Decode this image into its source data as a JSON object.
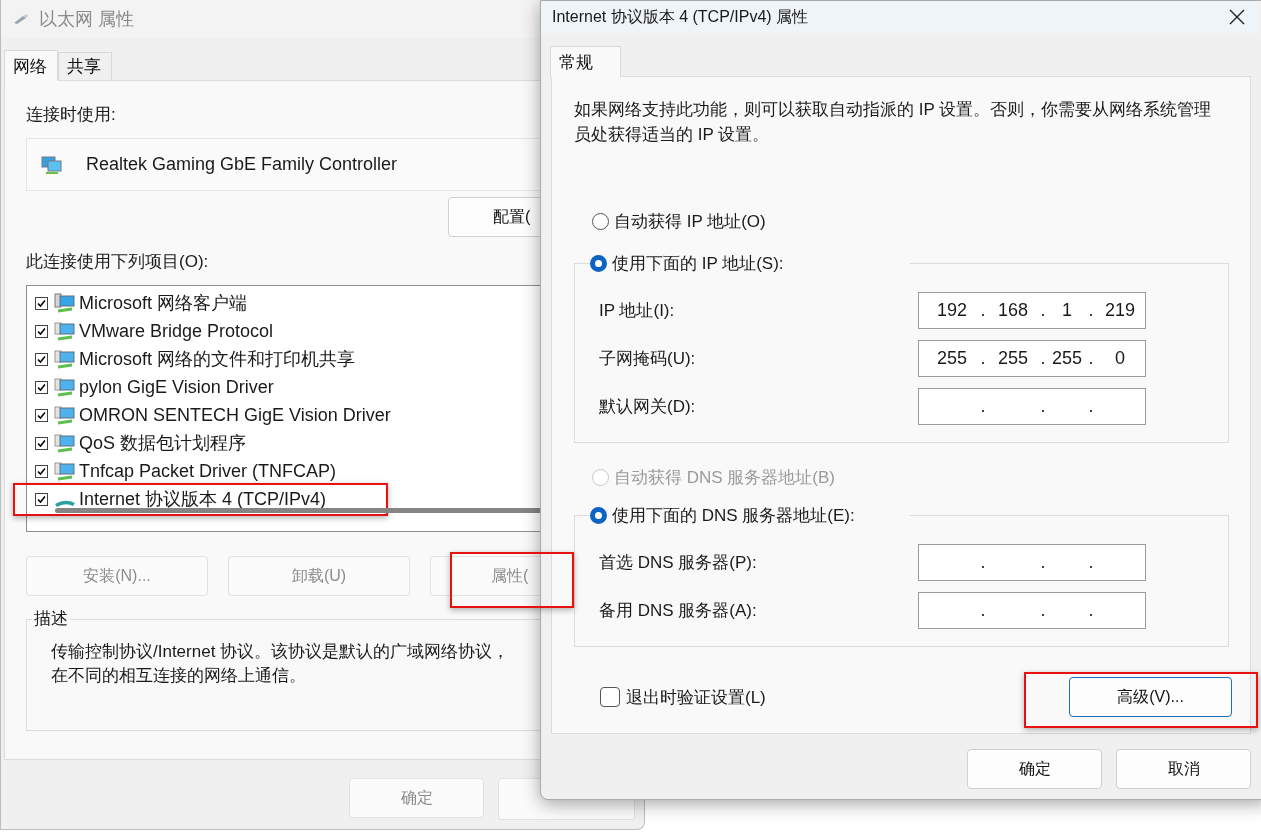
{
  "back_window": {
    "title": "以太网 属性",
    "tabs": [
      {
        "label": "网络",
        "selected": true
      },
      {
        "label": "共享",
        "selected": false
      }
    ],
    "connect_using_label": "连接时使用:",
    "adapter": "Realtek Gaming GbE Family Controller",
    "configure_button": "配置(",
    "items_label": "此连接使用下列项目(O):",
    "items": [
      {
        "label": "Microsoft 网络客户端",
        "checked": true,
        "highlighted": false,
        "kind": "client"
      },
      {
        "label": "VMware Bridge Protocol",
        "checked": true,
        "highlighted": false,
        "kind": "service"
      },
      {
        "label": "Microsoft 网络的文件和打印机共享",
        "checked": true,
        "highlighted": false,
        "kind": "service"
      },
      {
        "label": "pylon GigE Vision Driver",
        "checked": true,
        "highlighted": false,
        "kind": "service"
      },
      {
        "label": "OMRON SENTECH GigE Vision Driver",
        "checked": true,
        "highlighted": false,
        "kind": "service"
      },
      {
        "label": "QoS 数据包计划程序",
        "checked": true,
        "highlighted": false,
        "kind": "service"
      },
      {
        "label": "Tnfcap Packet Driver (TNFCAP)",
        "checked": true,
        "highlighted": false,
        "kind": "service"
      },
      {
        "label": "Internet 协议版本 4 (TCP/IPv4)",
        "checked": true,
        "highlighted": true,
        "kind": "protocol"
      }
    ],
    "buttons": [
      {
        "label": "安装(N)...",
        "highlighted": false
      },
      {
        "label": "卸载(U)",
        "highlighted": false
      },
      {
        "label": "属性(",
        "highlighted": true
      }
    ],
    "description_title": "描述",
    "description_lines": [
      "传输控制协议/Internet 协议。该协议是默认的广域网络协议，",
      "在不同的相互连接的网络上通信。"
    ],
    "ok_button": "确定"
  },
  "front_window": {
    "title": "Internet 协议版本 4 (TCP/IPv4) 属性",
    "tabs": [
      {
        "label": "常规",
        "selected": true
      }
    ],
    "intro": "如果网络支持此功能，则可以获取自动指派的 IP 设置。否则，你需要从网络系统管理员处获得适当的 IP 设置。",
    "ip_auto": {
      "label": "自动获得 IP 地址(O)",
      "selected": false,
      "disabled": false
    },
    "ip_manual": {
      "label": "使用下面的 IP 地址(S):",
      "selected": true,
      "disabled": false
    },
    "ip_fields": [
      {
        "label": "IP 地址(I):",
        "octets": [
          "192",
          "168",
          "1",
          "219"
        ],
        "dots": [
          ".",
          ".",
          "."
        ]
      },
      {
        "label": "子网掩码(U):",
        "octets": [
          "255",
          "255",
          "255",
          "0"
        ],
        "dots": [
          ".",
          ".",
          "."
        ]
      },
      {
        "label": "默认网关(D):",
        "dots": [
          ".",
          ".",
          "."
        ]
      }
    ],
    "dns_auto": {
      "label": "自动获得 DNS 服务器地址(B)",
      "selected": false,
      "disabled": true
    },
    "dns_manual": {
      "label": "使用下面的 DNS 服务器地址(E):",
      "selected": true,
      "disabled": false
    },
    "dns_fields": [
      {
        "label": "首选 DNS 服务器(P):",
        "dots": [
          ".",
          ".",
          "."
        ]
      },
      {
        "label": "备用 DNS 服务器(A):",
        "dots": [
          ".",
          ".",
          "."
        ]
      }
    ],
    "validate": {
      "label": "退出时验证设置(L)",
      "checked": false
    },
    "advanced_button": {
      "label": "高级(V)...",
      "highlighted": true
    },
    "ok_button": "确定",
    "cancel_button": "取消"
  }
}
